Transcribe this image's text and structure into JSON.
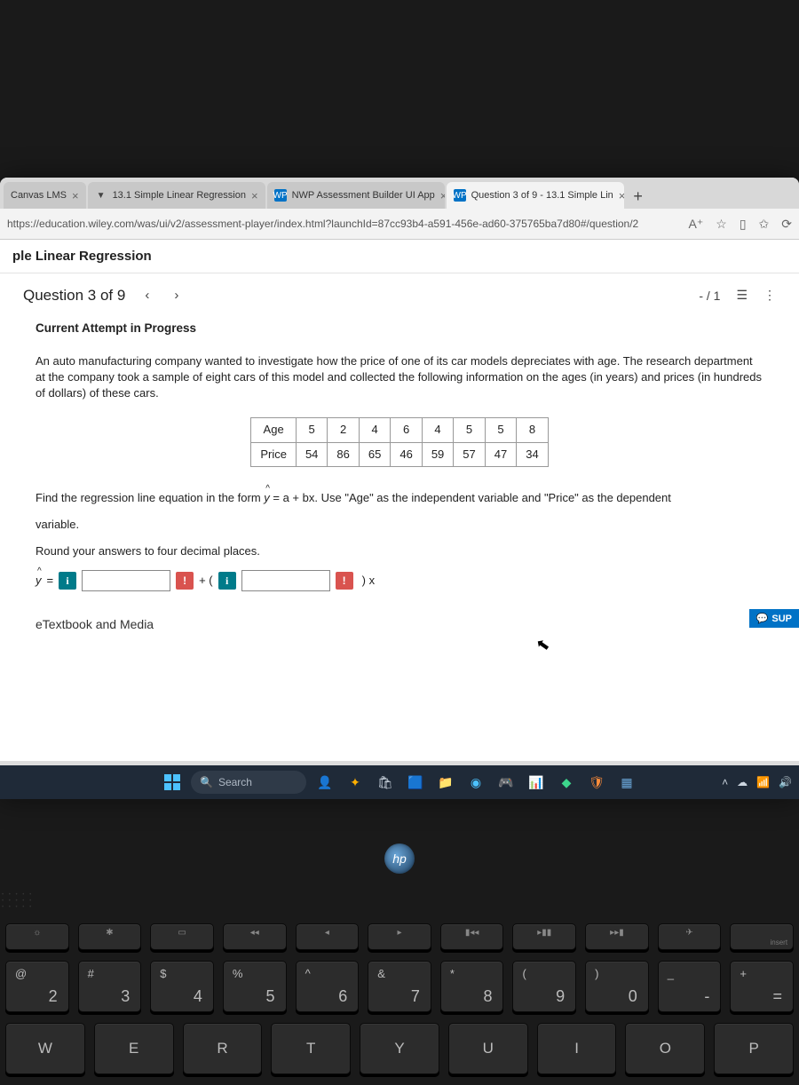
{
  "tabs": [
    {
      "label": "Canvas LMS",
      "favicon": "",
      "bg": "#c8c8c8"
    },
    {
      "label": "13.1 Simple Linear Regression",
      "favicon": "▼",
      "bg": "#c8c8c8"
    },
    {
      "label": "NWP Assessment Builder UI App",
      "favicon": "WP",
      "faviconBg": "#0072c6",
      "bg": "#c8c8c8"
    },
    {
      "label": "Question 3 of 9 - 13.1 Simple Lin",
      "favicon": "WP",
      "faviconBg": "#0072c6",
      "bg": "#f3f3f3",
      "active": true
    }
  ],
  "newtab_label": "+",
  "url": "https://education.wiley.com/was/ui/v2/assessment-player/index.html?launchId=87cc93b4-a591-456e-ad60-375765ba7d80#/question/2",
  "addr_icons": {
    "read": "A⁺",
    "star": "☆",
    "split": "▯",
    "collection": "✩",
    "sync": "⟳"
  },
  "page_header": "ple Linear Regression",
  "question": {
    "counter": "Question 3 of 9",
    "prev": "‹",
    "next": "›",
    "score": "- / 1"
  },
  "attempt_label": "Current Attempt in Progress",
  "prompt_text": "An auto manufacturing company wanted to investigate how the price of one of its car models depreciates with age. The research department at the company took a sample of eight cars of this model and collected the following information on the ages (in years) and prices (in hundreds of dollars) of these cars.",
  "table": {
    "rows": [
      {
        "label": "Age",
        "vals": [
          "5",
          "2",
          "4",
          "6",
          "4",
          "5",
          "5",
          "8"
        ]
      },
      {
        "label": "Price",
        "vals": [
          "54",
          "86",
          "65",
          "46",
          "59",
          "57",
          "47",
          "34"
        ]
      }
    ]
  },
  "instruction1a": "Find the regression line equation in the form ",
  "instruction1b": " = a + bx. Use \"Age\" as the independent variable and \"Price\" as the dependent",
  "instruction1c": "variable.",
  "instruction2": "Round your answers to four decimal places.",
  "eq": {
    "yhat_y": "y",
    "yhat_hat": "^",
    "equals": "=",
    "plus_open": "+ (",
    "x_close": ") x"
  },
  "etext_label": "eTextbook and Media",
  "support_label": "SUP",
  "search_placeholder": "Search",
  "hp": "hp",
  "fn_keys": [
    {
      "sym": "☼",
      "lab": ""
    },
    {
      "sym": "✱",
      "lab": ""
    },
    {
      "sym": "▭",
      "lab": ""
    },
    {
      "sym": "◂◂",
      "lab": ""
    },
    {
      "sym": "◂",
      "lab": ""
    },
    {
      "sym": "▸",
      "lab": ""
    },
    {
      "sym": "▮◂◂",
      "lab": ""
    },
    {
      "sym": "▸▮▮",
      "lab": ""
    },
    {
      "sym": "▸▸▮",
      "lab": ""
    },
    {
      "sym": "✈",
      "lab": ""
    },
    {
      "sym": "",
      "lab": "insert"
    }
  ],
  "num_keys": [
    {
      "top": "@",
      "bot": "2"
    },
    {
      "top": "#",
      "bot": "3"
    },
    {
      "top": "$",
      "bot": "4"
    },
    {
      "top": "%",
      "bot": "5"
    },
    {
      "top": "^",
      "bot": "6"
    },
    {
      "top": "&",
      "bot": "7"
    },
    {
      "top": "*",
      "bot": "8"
    },
    {
      "top": "(",
      "bot": "9"
    },
    {
      "top": ")",
      "bot": "0"
    },
    {
      "top": "_",
      "bot": "-"
    },
    {
      "top": "+",
      "bot": "="
    }
  ],
  "letter_keys": [
    "W",
    "E",
    "R",
    "T",
    "Y",
    "U",
    "I",
    "O",
    "P"
  ]
}
